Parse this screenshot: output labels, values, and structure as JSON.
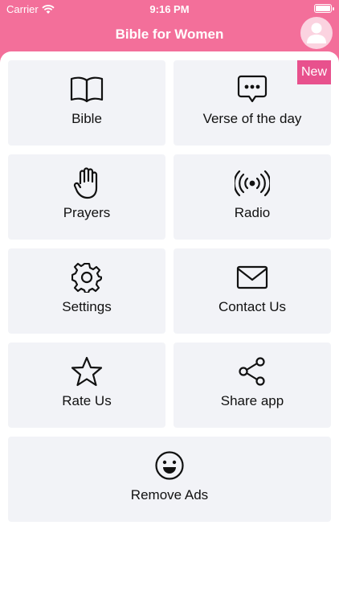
{
  "status_bar": {
    "carrier": "Carrier",
    "time": "9:16 PM"
  },
  "header": {
    "title": "Bible for Women"
  },
  "colors": {
    "header": "#f36f9a",
    "badge": "#e8518d",
    "tile": "#f2f3f7"
  },
  "tiles": [
    {
      "label": "Bible",
      "icon": "book-icon"
    },
    {
      "label": "Verse of the day",
      "icon": "chat-bubble-icon",
      "badge": "New"
    },
    {
      "label": "Prayers",
      "icon": "hand-icon"
    },
    {
      "label": "Radio",
      "icon": "broadcast-icon"
    },
    {
      "label": "Settings",
      "icon": "gear-icon"
    },
    {
      "label": "Contact Us",
      "icon": "mail-icon"
    },
    {
      "label": "Rate Us",
      "icon": "star-icon"
    },
    {
      "label": "Share app",
      "icon": "share-icon"
    },
    {
      "label": "Remove Ads",
      "icon": "smiley-icon"
    }
  ]
}
